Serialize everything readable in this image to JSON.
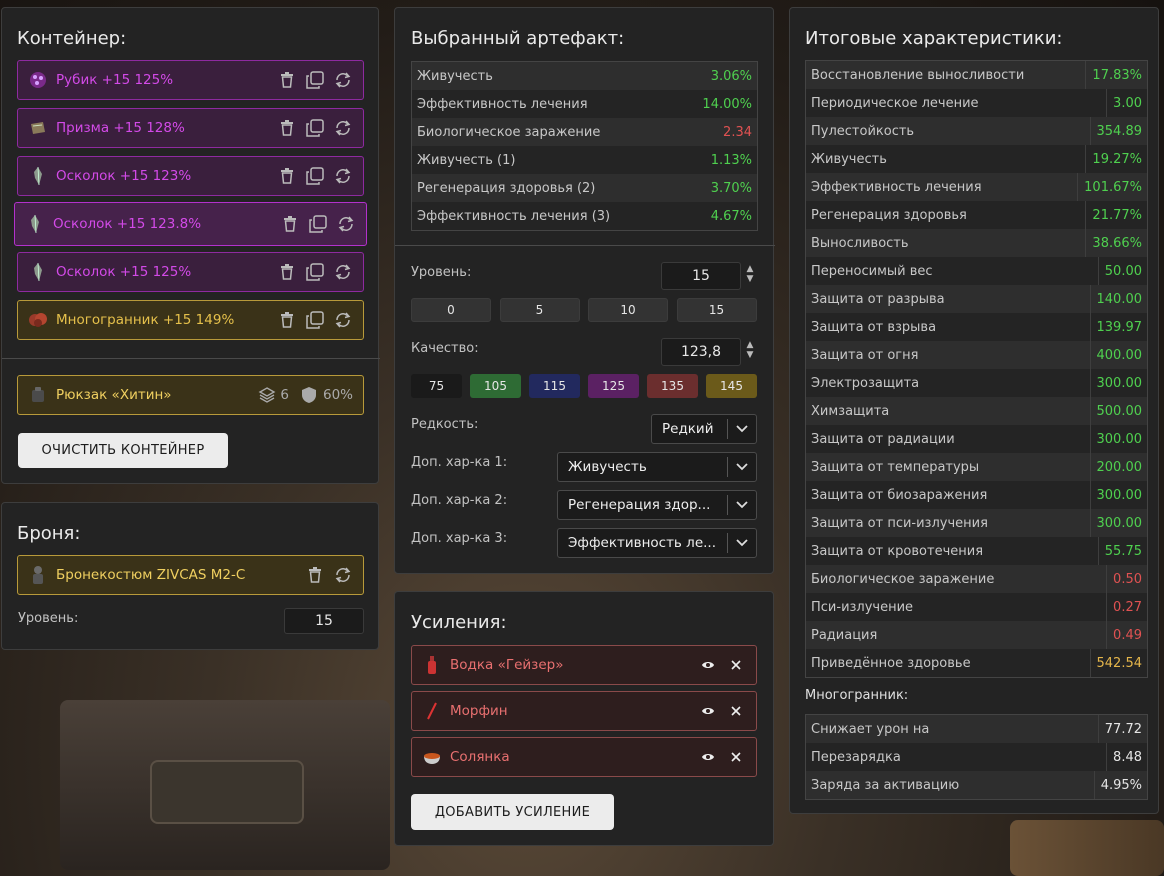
{
  "container": {
    "title": "Контейнер:",
    "items": [
      {
        "label": "Рубик +15 125%",
        "style": "purple",
        "icon": "rubik-cube-icon"
      },
      {
        "label": "Призма +15 128%",
        "style": "purple",
        "icon": "prism-icon"
      },
      {
        "label": "Осколок +15 123%",
        "style": "purple",
        "icon": "shard-icon"
      },
      {
        "label": "Осколок +15 123.8%",
        "style": "purple",
        "icon": "shard-icon"
      },
      {
        "label": "Осколок +15 125%",
        "style": "purple",
        "icon": "shard-icon"
      },
      {
        "label": "Многогранник +15 149%",
        "style": "gold",
        "icon": "polyhedron-icon"
      }
    ],
    "backpack": {
      "label": "Рюкзак «Хитин»",
      "slots": "6",
      "protection": "60%"
    },
    "clear_button": "ОЧИСТИТЬ КОНТЕЙНЕР"
  },
  "armor": {
    "title": "Броня:",
    "item": "Бронекостюм ZIVCAS M2-C",
    "level_label": "Уровень:",
    "level_value": "15"
  },
  "artifact": {
    "title": "Выбранный артефакт:",
    "stats": [
      {
        "name": "Живучесть",
        "value": "3.06%",
        "color": "g"
      },
      {
        "name": "Эффективность лечения",
        "value": "14.00%",
        "color": "g"
      },
      {
        "name": "Биологическое заражение",
        "value": "2.34",
        "color": "r"
      },
      {
        "name": "Живучесть (1)",
        "value": "1.13%",
        "color": "g"
      },
      {
        "name": "Регенерация здоровья (2)",
        "value": "3.70%",
        "color": "g"
      },
      {
        "name": "Эффективность лечения (3)",
        "value": "4.67%",
        "color": "g"
      }
    ],
    "level_label": "Уровень:",
    "level_value": "15",
    "level_presets": [
      "0",
      "5",
      "10",
      "15"
    ],
    "quality_label": "Качество:",
    "quality_value": "123,8",
    "quality_presets": [
      {
        "label": "75",
        "color": "#1a1a1a"
      },
      {
        "label": "105",
        "color": "#2e6b34"
      },
      {
        "label": "115",
        "color": "#22295e"
      },
      {
        "label": "125",
        "color": "#5b2163"
      },
      {
        "label": "135",
        "color": "#6b2e2e"
      },
      {
        "label": "145",
        "color": "#6b5a1a"
      }
    ],
    "rarity_label": "Редкость:",
    "rarity_value": "Редкий",
    "extra1_label": "Доп. хар-ка 1:",
    "extra1_value": "Живучесть",
    "extra2_label": "Доп. хар-ка 2:",
    "extra2_value": "Регенерация здор...",
    "extra3_label": "Доп. хар-ка 3:",
    "extra3_value": "Эффективность ле..."
  },
  "boosts": {
    "title": "Усиления:",
    "items": [
      {
        "label": "Водка «Гейзер»",
        "icon": "bottle-icon"
      },
      {
        "label": "Морфин",
        "icon": "syringe-icon"
      },
      {
        "label": "Солянка",
        "icon": "soup-bowl-icon"
      }
    ],
    "add_button": "ДОБАВИТЬ УСИЛЕНИЕ"
  },
  "totals": {
    "title": "Итоговые характеристики:",
    "stats": [
      {
        "name": "Восстановление выносливости",
        "value": "17.83%",
        "color": "g"
      },
      {
        "name": "Периодическое лечение",
        "value": "3.00",
        "color": "g"
      },
      {
        "name": "Пулестойкость",
        "value": "354.89",
        "color": "g"
      },
      {
        "name": "Живучесть",
        "value": "19.27%",
        "color": "g"
      },
      {
        "name": "Эффективность лечения",
        "value": "101.67%",
        "color": "g"
      },
      {
        "name": "Регенерация здоровья",
        "value": "21.77%",
        "color": "g"
      },
      {
        "name": "Выносливость",
        "value": "38.66%",
        "color": "g"
      },
      {
        "name": "Переносимый вес",
        "value": "50.00",
        "color": "g"
      },
      {
        "name": "Защита от разрыва",
        "value": "140.00",
        "color": "g"
      },
      {
        "name": "Защита от взрыва",
        "value": "139.97",
        "color": "g"
      },
      {
        "name": "Защита от огня",
        "value": "400.00",
        "color": "g"
      },
      {
        "name": "Электрозащита",
        "value": "300.00",
        "color": "g"
      },
      {
        "name": "Химзащита",
        "value": "500.00",
        "color": "g"
      },
      {
        "name": "Защита от радиации",
        "value": "300.00",
        "color": "g"
      },
      {
        "name": "Защита от температуры",
        "value": "200.00",
        "color": "g"
      },
      {
        "name": "Защита от биозаражения",
        "value": "300.00",
        "color": "g"
      },
      {
        "name": "Защита от пси-излучения",
        "value": "300.00",
        "color": "g"
      },
      {
        "name": "Защита от кровотечения",
        "value": "55.75",
        "color": "g"
      },
      {
        "name": "Биологическое заражение",
        "value": "0.50",
        "color": "r"
      },
      {
        "name": "Пси-излучение",
        "value": "0.27",
        "color": "r"
      },
      {
        "name": "Радиация",
        "value": "0.49",
        "color": "r"
      },
      {
        "name": "Приведённое здоровье",
        "value": "542.54",
        "color": "y"
      }
    ],
    "poly_title": "Многогранник:",
    "poly_stats": [
      {
        "name": "Снижает урон на",
        "value": "77.72",
        "color": "w"
      },
      {
        "name": "Перезарядка",
        "value": "8.48",
        "color": "w"
      },
      {
        "name": "Заряда за активацию",
        "value": "4.95%",
        "color": "w"
      }
    ]
  }
}
